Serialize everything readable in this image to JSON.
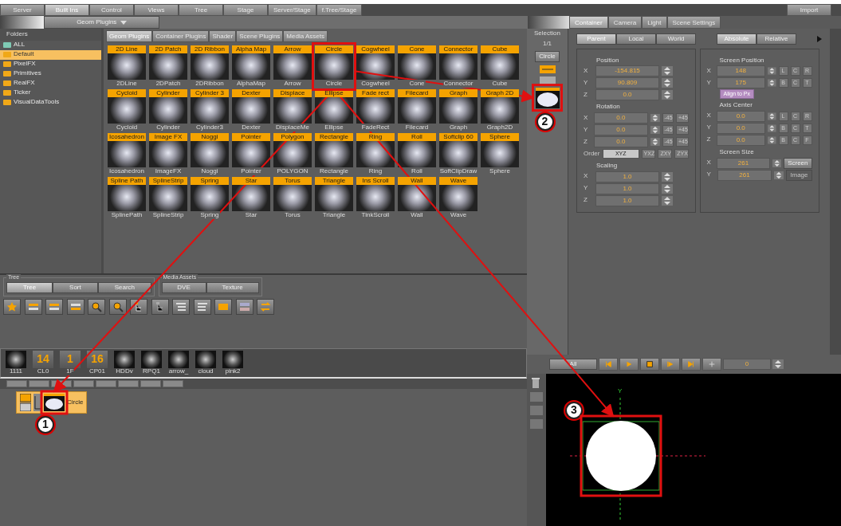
{
  "menu_tabs": [
    {
      "label": "Server",
      "selected": false
    },
    {
      "label": "Built Ins",
      "selected": true
    },
    {
      "label": "Control",
      "selected": false
    },
    {
      "label": "Views",
      "selected": false
    },
    {
      "label": "Tree",
      "selected": false
    },
    {
      "label": "Stage",
      "selected": false
    },
    {
      "label": "Server/Stage",
      "selected": false
    },
    {
      "label": "f.Tree/Stage",
      "selected": false
    }
  ],
  "import_button": "Import",
  "plugin_dropdown": {
    "value": "Geom Plugins"
  },
  "folders": {
    "title": "Folders",
    "items": [
      {
        "label": "ALL",
        "selected": false,
        "color": "#7fcab5"
      },
      {
        "label": "Default",
        "selected": true,
        "color": "#f0a818"
      },
      {
        "label": "PixelFX",
        "selected": false,
        "color": "#f0a818"
      },
      {
        "label": "Primitives",
        "selected": false,
        "color": "#f0a818"
      },
      {
        "label": "RealFX",
        "selected": false,
        "color": "#f0a818"
      },
      {
        "label": "Ticker",
        "selected": false,
        "color": "#f0a818"
      },
      {
        "label": "VisualDataTools",
        "selected": false,
        "color": "#f0a818"
      }
    ]
  },
  "plugin_tabs": [
    {
      "label": "Geom Plugins",
      "selected": true
    },
    {
      "label": "Container Plugins",
      "selected": false
    },
    {
      "label": "Shader",
      "selected": false
    },
    {
      "label": "Scene Plugins",
      "selected": false
    },
    {
      "label": "Media Assets",
      "selected": false
    }
  ],
  "plugins": [
    {
      "label": "2D Line",
      "caption": "2DLine",
      "highlighted": false
    },
    {
      "label": "2D Patch",
      "caption": "2DPatch",
      "highlighted": false
    },
    {
      "label": "2D Ribbon",
      "caption": "2DRibbon",
      "highlighted": false
    },
    {
      "label": "Alpha Map",
      "caption": "AlphaMap",
      "highlighted": false
    },
    {
      "label": "Arrow",
      "caption": "Arrow",
      "highlighted": false
    },
    {
      "label": "Circle",
      "caption": "Circle",
      "highlighted": true
    },
    {
      "label": "Cogwheel",
      "caption": "Cogwheel",
      "highlighted": false
    },
    {
      "label": "Cone",
      "caption": "Cone",
      "highlighted": false
    },
    {
      "label": "Connector",
      "caption": "Connector",
      "highlighted": false
    },
    {
      "label": "Cube",
      "caption": "Cube",
      "highlighted": false
    },
    {
      "label": "Cycloid",
      "caption": "Cycloid",
      "highlighted": false
    },
    {
      "label": "Cylinder",
      "caption": "Cylinder",
      "highlighted": false
    },
    {
      "label": "Cylinder 3",
      "caption": "Cylinder3",
      "highlighted": false
    },
    {
      "label": "Dexter",
      "caption": "Dexter",
      "highlighted": false
    },
    {
      "label": "Displace",
      "caption": "DisplaceMe",
      "highlighted": false
    },
    {
      "label": "Ellipse",
      "caption": "Ellipse",
      "highlighted": false
    },
    {
      "label": "Fade rect",
      "caption": "FadeRect",
      "highlighted": false
    },
    {
      "label": "Filecard",
      "caption": "Filecard",
      "highlighted": false
    },
    {
      "label": "Graph",
      "caption": "Graph",
      "highlighted": false
    },
    {
      "label": "Graph 2D",
      "caption": "Graph2D",
      "highlighted": false
    },
    {
      "label": "Icosahedron",
      "caption": "Icosahedron",
      "highlighted": false
    },
    {
      "label": "Image FX",
      "caption": "ImageFX",
      "highlighted": false
    },
    {
      "label": "Noggi",
      "caption": "Noggi",
      "highlighted": false
    },
    {
      "label": "Pointer",
      "caption": "Pointer",
      "highlighted": false
    },
    {
      "label": "Polygon",
      "caption": "POLYGON",
      "highlighted": false
    },
    {
      "label": "Rectangle",
      "caption": "Rectangle",
      "highlighted": false
    },
    {
      "label": "Ring",
      "caption": "Ring",
      "highlighted": false
    },
    {
      "label": "Roll",
      "caption": "Roll",
      "highlighted": false
    },
    {
      "label": "Softclip 60",
      "caption": "SoftClipDraw",
      "highlighted": false
    },
    {
      "label": "Sphere",
      "caption": "Sphere",
      "highlighted": false
    },
    {
      "label": "Spline Path",
      "caption": "SplinePath",
      "highlighted": false
    },
    {
      "label": "SplineStrip",
      "caption": "SplineStrip",
      "highlighted": false
    },
    {
      "label": "Spring",
      "caption": "Spring",
      "highlighted": false
    },
    {
      "label": "Star",
      "caption": "Star",
      "highlighted": false
    },
    {
      "label": "Torus",
      "caption": "Torus",
      "highlighted": false
    },
    {
      "label": "Triangle",
      "caption": "Triangle",
      "highlighted": false
    },
    {
      "label": "Ins Scroll",
      "caption": "TinkScroll",
      "highlighted": false
    },
    {
      "label": "Wall",
      "caption": "Wall",
      "highlighted": false
    },
    {
      "label": "Wave",
      "caption": "Wave",
      "highlighted": false
    }
  ],
  "tree_panel": {
    "title": "Tree",
    "tabs": [
      {
        "label": "Tree",
        "selected": true
      },
      {
        "label": "Sort",
        "selected": false
      },
      {
        "label": "Search",
        "selected": false
      }
    ]
  },
  "media_assets_panel": {
    "title": "Media Assets",
    "tabs": [
      {
        "label": "DVE",
        "selected": false
      },
      {
        "label": "Texture",
        "selected": false
      }
    ]
  },
  "assets": [
    {
      "caption": "1111"
    },
    {
      "number": "14",
      "caption": "CL0"
    },
    {
      "number": "1",
      "caption": "1F"
    },
    {
      "number": "16",
      "caption": "CP01"
    },
    {
      "caption": "HDDv"
    },
    {
      "caption": "RPQ1"
    },
    {
      "caption": "arrow_"
    },
    {
      "caption": "cloud"
    },
    {
      "caption": "pink2"
    }
  ],
  "scene_tree": {
    "container": {
      "label": "Circle",
      "selected": true
    }
  },
  "property_tabs": [
    {
      "label": "Container",
      "selected": true
    },
    {
      "label": "Camera",
      "selected": false
    },
    {
      "label": "Light",
      "selected": false
    },
    {
      "label": "Scene Settings",
      "selected": false
    }
  ],
  "selection": {
    "title": "Selection",
    "count": "1/1",
    "button": "Circle"
  },
  "transform_modes": [
    {
      "label": "Parent",
      "selected": true
    },
    {
      "label": "Local",
      "selected": false
    },
    {
      "label": "World",
      "selected": false
    }
  ],
  "reference_modes": [
    {
      "label": "Absolute",
      "selected": true
    },
    {
      "label": "Relative",
      "selected": false
    }
  ],
  "position": {
    "title": "Position",
    "fields": [
      {
        "axis": "X",
        "value": "-154.815"
      },
      {
        "axis": "Y",
        "value": "90.809"
      },
      {
        "axis": "Z",
        "value": "0.0"
      }
    ]
  },
  "rotation": {
    "title": "Rotation",
    "fields": [
      {
        "axis": "X",
        "value": "0.0",
        "steps": [
          "-45",
          "+45"
        ]
      },
      {
        "axis": "Y",
        "value": "0.0",
        "steps": [
          "-45",
          "+45"
        ]
      },
      {
        "axis": "Z",
        "value": "0.0",
        "steps": [
          "-45",
          "+45"
        ]
      }
    ],
    "order_label": "Order",
    "orders": [
      {
        "label": "XYZ",
        "selected": true
      },
      {
        "label": "YXZ",
        "selected": false
      },
      {
        "label": "ZXY",
        "selected": false
      },
      {
        "label": "ZYX",
        "selected": false
      }
    ]
  },
  "scaling": {
    "title": "Scaling",
    "fields": [
      {
        "axis": "X",
        "value": "1.0"
      },
      {
        "axis": "Y",
        "value": "1.0"
      },
      {
        "axis": "Z",
        "value": "1.0"
      }
    ]
  },
  "screen_position": {
    "title": "Screen Position",
    "fields": [
      {
        "axis": "X",
        "value": "148",
        "align": [
          "L",
          "C",
          "R"
        ]
      },
      {
        "axis": "Y",
        "value": "175",
        "align": [
          "B",
          "C",
          "T"
        ]
      }
    ],
    "button": "Align to Px"
  },
  "axis_center": {
    "title": "Axis Center",
    "fields": [
      {
        "axis": "X",
        "value": "0.0",
        "align": [
          "L",
          "C",
          "R"
        ]
      },
      {
        "axis": "Y",
        "value": "0.0",
        "align": [
          "B",
          "C",
          "T"
        ]
      },
      {
        "axis": "Z",
        "value": "0.0",
        "align": [
          "B",
          "C",
          "F"
        ]
      }
    ]
  },
  "screen_size": {
    "title": "Screen Size",
    "fields": [
      {
        "axis": "X",
        "value": "261",
        "button": "Screen",
        "disabled": false
      },
      {
        "axis": "Y",
        "value": "261",
        "button": "Image",
        "disabled": true
      }
    ]
  },
  "player": {
    "filter": "All",
    "frame": "0"
  },
  "viewport": {
    "axis_label": "Y"
  },
  "callouts": [
    {
      "number": "1"
    },
    {
      "number": "2"
    },
    {
      "number": "3"
    }
  ]
}
